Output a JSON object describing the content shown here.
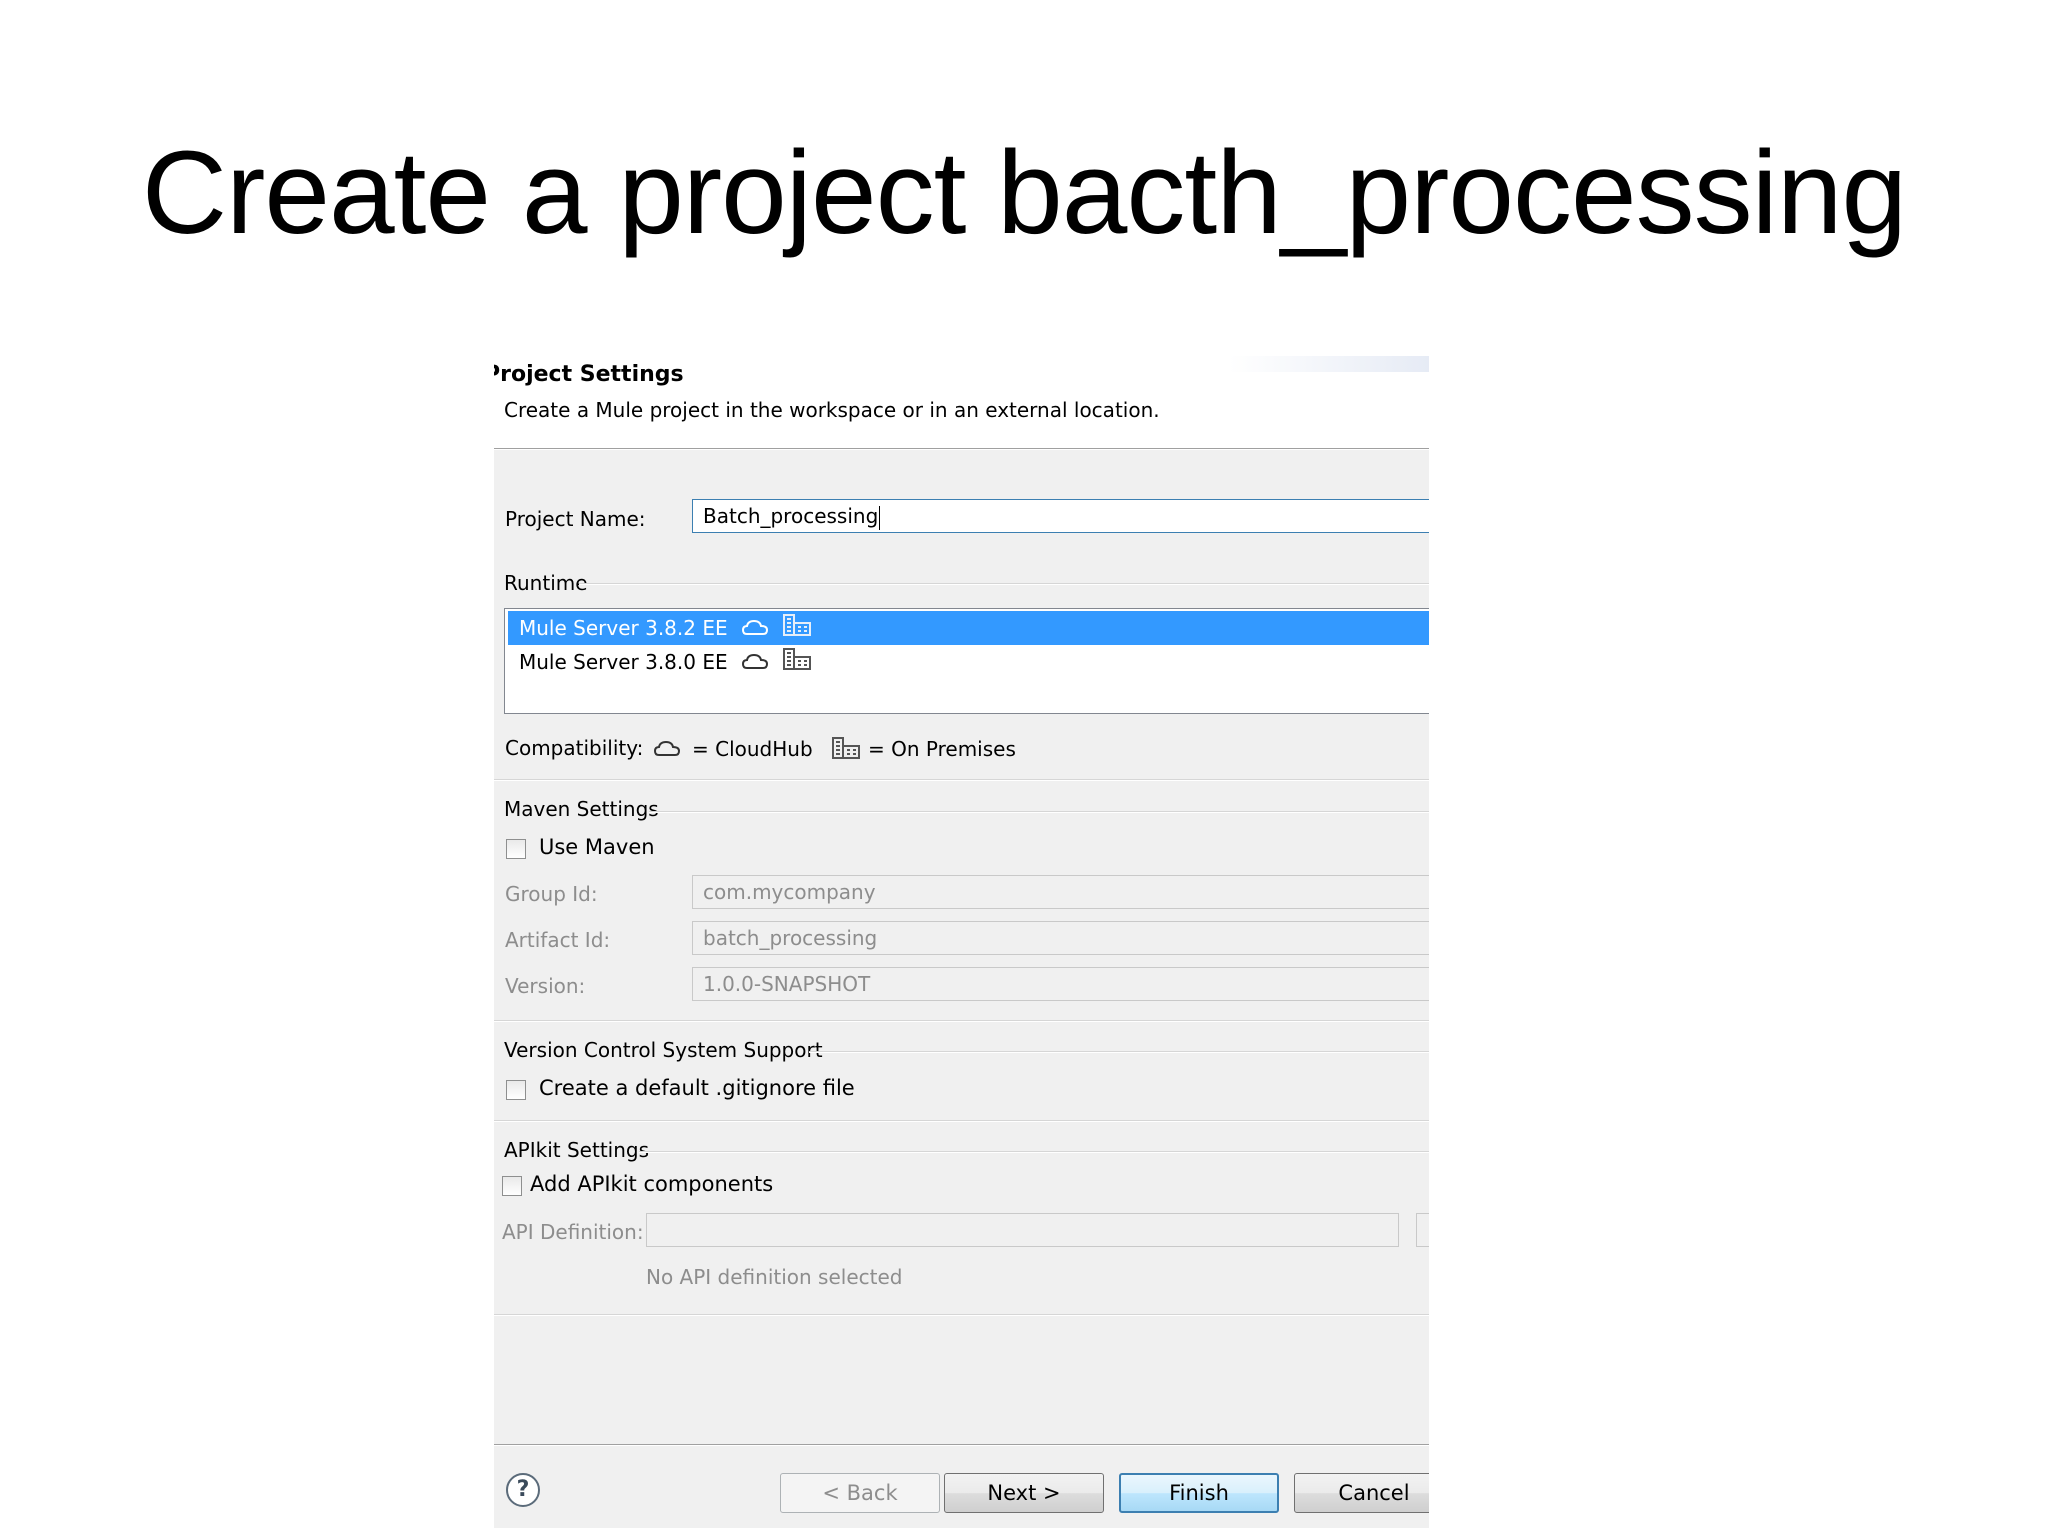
{
  "slide": {
    "title": "Create a project bacth_processing"
  },
  "dialog": {
    "title": "Project Settings",
    "description": "Create a Mule project in the workspace or in an external location.",
    "project_name": {
      "label": "Project Name:",
      "value": "Batch_processing"
    },
    "runtime": {
      "label": "Runtime",
      "items": [
        {
          "label": "Mule Server 3.8.2 EE",
          "selected": true
        },
        {
          "label": "Mule Server 3.8.0 EE",
          "selected": false
        }
      ]
    },
    "compatibility": {
      "label": "Compatibility:",
      "cloudhub": "= CloudHub",
      "on_premises": "= On Premises"
    },
    "maven": {
      "label": "Maven Settings",
      "use_maven": "Use Maven",
      "group_id_label": "Group Id:",
      "group_id": "com.mycompany",
      "artifact_id_label": "Artifact Id:",
      "artifact_id": "batch_processing",
      "version_label": "Version:",
      "version": "1.0.0-SNAPSHOT"
    },
    "vcs": {
      "label": "Version Control System Support",
      "gitignore": "Create a default .gitignore file"
    },
    "apikit": {
      "label": "APIkit Settings",
      "add_components": "Add APIkit components",
      "api_definition_label": "API Definition:",
      "api_definition": "",
      "status": "No API definition selected"
    },
    "buttons": {
      "help": "?",
      "back": "< Back",
      "next": "Next >",
      "finish": "Finish",
      "cancel": "Cancel"
    }
  },
  "icons": {
    "cloud": "cloud-icon",
    "building": "building-icon",
    "help": "help-icon"
  },
  "colors": {
    "selection": "#3399ff",
    "dialog_bg": "#f0f0f0",
    "default_button": "#3c7fb1"
  }
}
